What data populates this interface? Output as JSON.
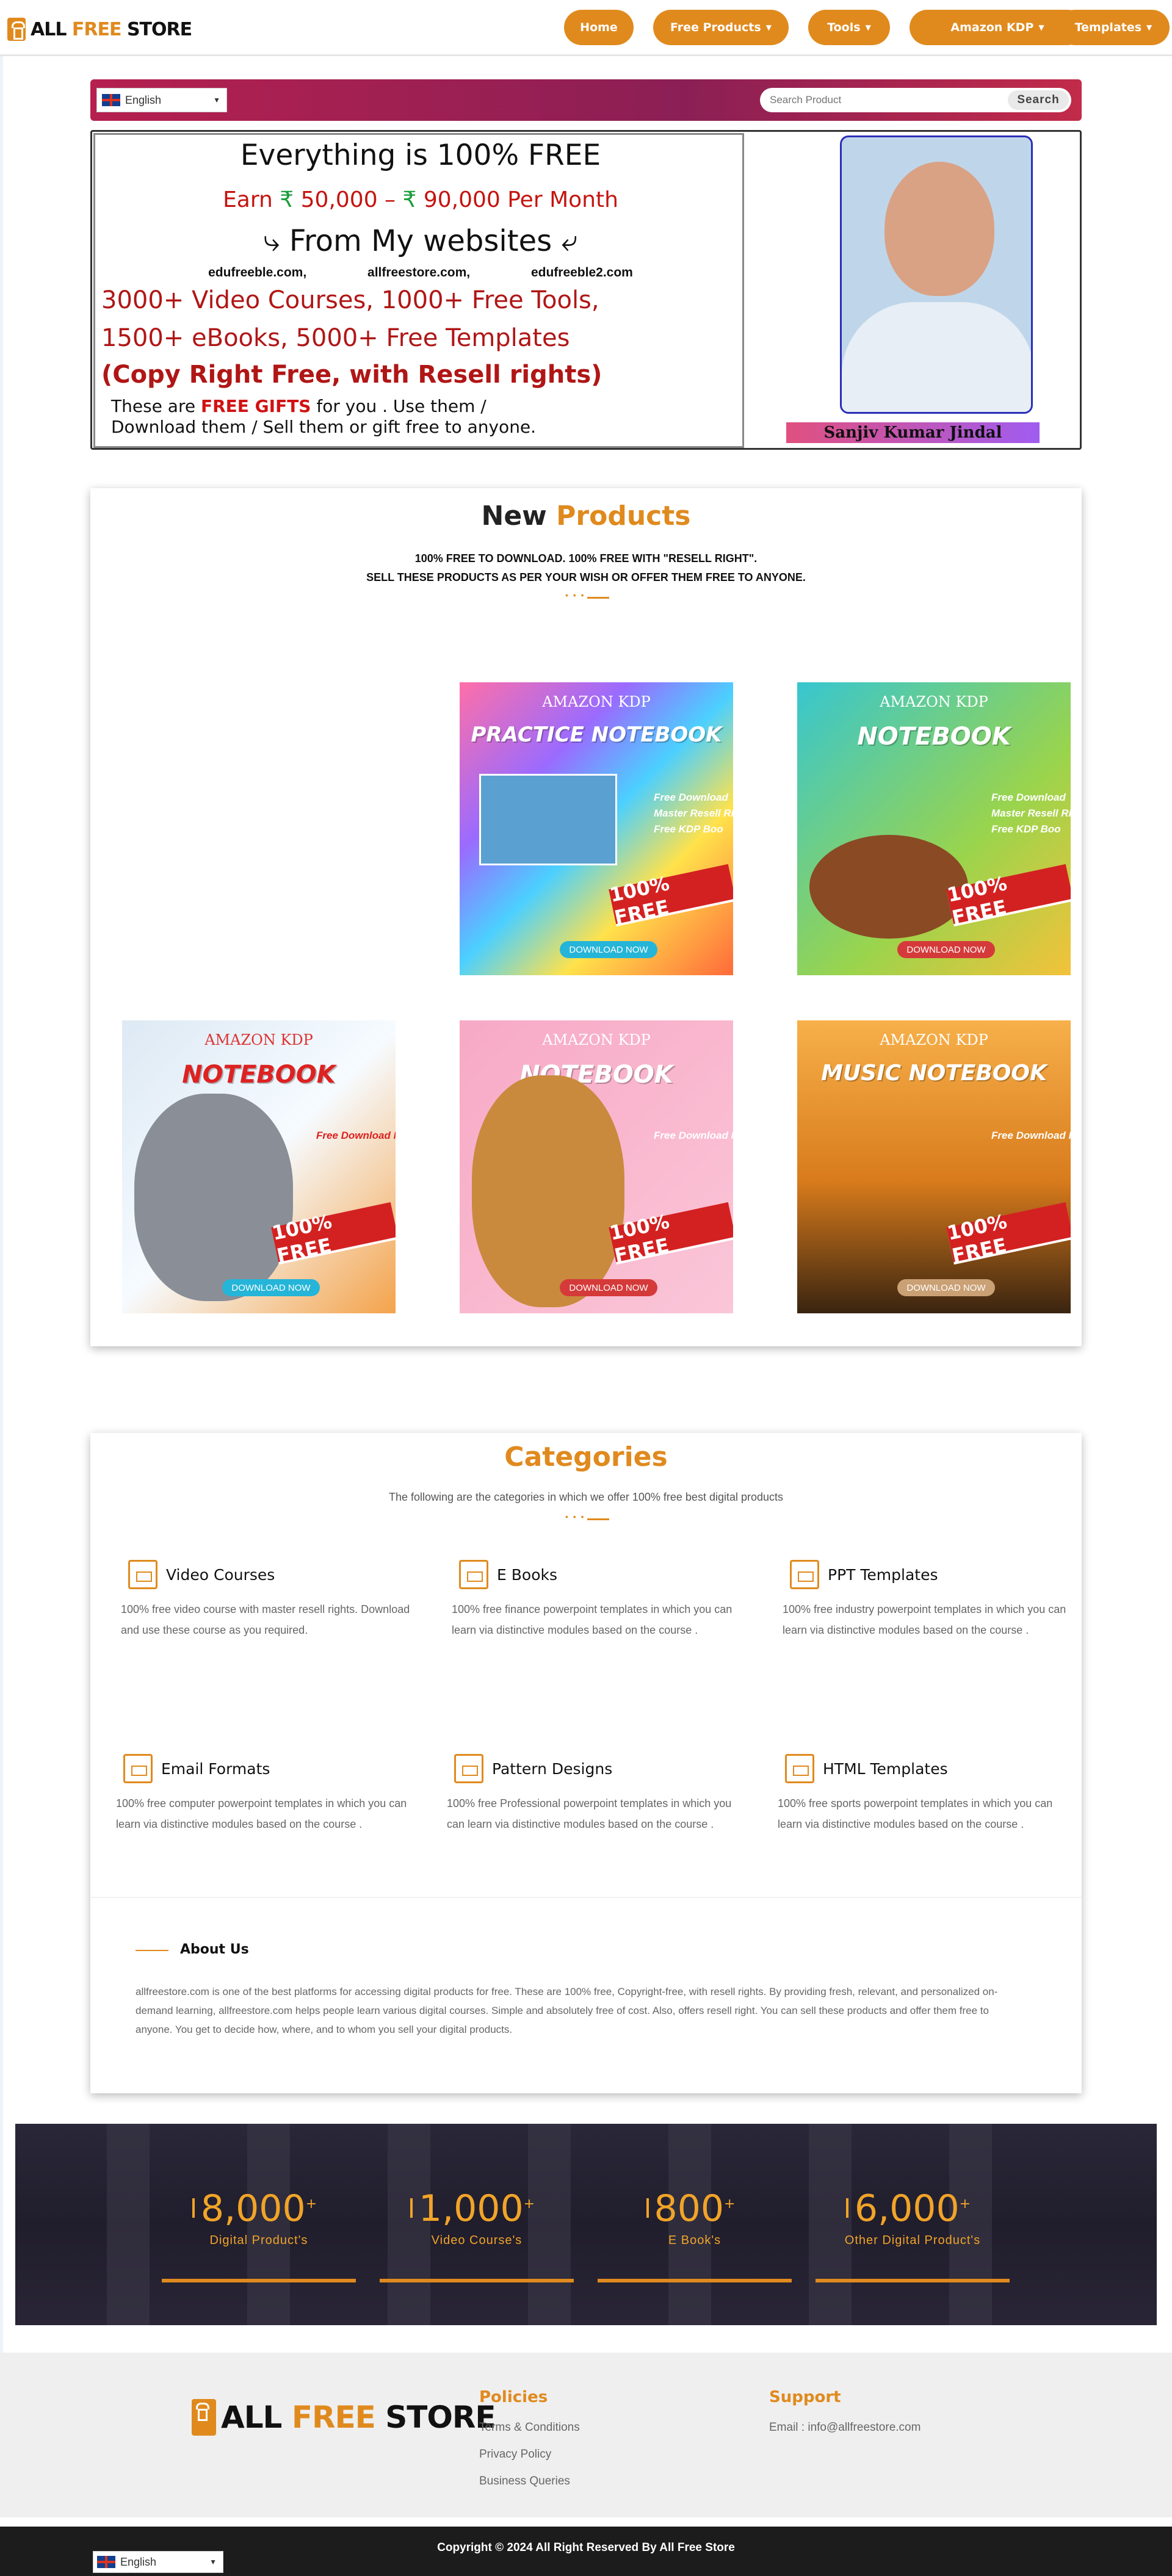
{
  "header": {
    "logo": {
      "all": "ALL ",
      "free": "FREE ",
      "store": "STORE"
    },
    "nav": [
      {
        "label": "Home"
      },
      {
        "label": "Free Products"
      },
      {
        "label": "Tools"
      },
      {
        "label": "Amazon KDP"
      },
      {
        "label": "Templates"
      }
    ]
  },
  "searchbar": {
    "language": "English",
    "search_placeholder": "Search Product",
    "search_button": "Search"
  },
  "hero": {
    "headline": "Everything is 100% FREE",
    "earn_prefix": "Earn ",
    "rupee": "₹",
    "amount1": " 50,000 – ",
    "amount2": " 90,000 Per Month",
    "from": "⤷ From My websites ⤶",
    "sites": [
      "edufreeble.com,",
      "allfreestore.com,",
      "edufreeble2.com"
    ],
    "line1": "3000+ Video Courses, 1000+ Free Tools,",
    "line2": "1500+ eBooks, 5000+ Free Templates",
    "line3": "(Copy Right Free, with Resell rights)",
    "gift_prefix": "These are ",
    "gift_bold": "FREE GIFTS",
    "gift_suffix": " for you . Use them / Download them / Sell them or gift free to anyone.",
    "person_name": "Sanjiv Kumar Jindal"
  },
  "new_products": {
    "title_a": "New ",
    "title_b": "Products",
    "sub1": "100% FREE TO DOWNLOAD. 100% FREE WITH \"RESELL RIGHT\".",
    "sub2": "SELL THESE PRODUCTS AS PER YOUR WISH OR OFFER THEM FREE TO ANYONE.",
    "items": [
      {
        "kdp": "AMAZON KDP",
        "title": "PRACTICE NOTEBOOK",
        "bullets": "Free Download\nMaster Resell Rig\nFree KDP Boo",
        "badge": "100% FREE",
        "cta": "DOWNLOAD NOW"
      },
      {
        "kdp": "AMAZON KDP",
        "title": "NOTEBOOK",
        "bullets": "Free Download\nMaster Resell Rig\nFree KDP Boo",
        "badge": "100% FREE",
        "cta": "DOWNLOAD NOW"
      },
      {
        "kdp": "AMAZON KDP",
        "title": "NOTEBOOK",
        "bullets": "Free Download\nMaster Resell Rig\nFree KDP Boo",
        "badge": "100% FREE",
        "cta": "DOWNLOAD NOW"
      },
      {
        "kdp": "AMAZON KDP",
        "title": "NOTEBOOK",
        "bullets": "Free Download\nMaster Resell Rig\nFree KDP Boo",
        "badge": "100% FREE",
        "cta": "DOWNLOAD NOW"
      },
      {
        "kdp": "AMAZON KDP",
        "title": "MUSIC NOTEBOOK",
        "bullets": "Free Download\nMaster Resell Rig\nFree KDP Boo",
        "badge": "100% FREE",
        "cta": "DOWNLOAD NOW"
      }
    ]
  },
  "categories": {
    "title": "Categories",
    "subtitle": "The following are the categories in which we offer 100% free best digital products",
    "items": [
      {
        "title": "Video Courses",
        "desc": "100% free video course with master resell rights. Download and use these course as you required."
      },
      {
        "title": "E Books",
        "desc": "100% free finance powerpoint templates in which you can learn via distinctive modules based on the course ."
      },
      {
        "title": "PPT Templates",
        "desc": "100% free industry powerpoint templates in which you can learn via distinctive modules based on the course ."
      },
      {
        "title": "Email Formats",
        "desc": "100% free computer powerpoint templates in which you can learn via distinctive modules based on the course ."
      },
      {
        "title": "Pattern Designs",
        "desc": "100% free Professional powerpoint templates in which you can learn via distinctive modules based on the course ."
      },
      {
        "title": "HTML Templates",
        "desc": "100% free sports powerpoint templates in which you can learn via distinctive modules based on the course ."
      }
    ],
    "about_title": "About Us",
    "about_text": "allfreestore.com is one of the best platforms for accessing digital products for free. These are 100% free, Copyright-free, with resell rights. By providing fresh, relevant, and personalized on-demand learning, allfreestore.com helps people learn various digital courses. Simple and absolutely free of cost. Also, offers resell right. You can sell these products and offer them free to anyone. You get to decide how, where, and to whom you sell your digital products."
  },
  "stats": [
    {
      "value": "8,000",
      "plus": "+",
      "label": "Digital Product's"
    },
    {
      "value": "1,000",
      "plus": "+",
      "label": "Video Course's"
    },
    {
      "value": "800",
      "plus": "+",
      "label": "E Book's"
    },
    {
      "value": "6,000",
      "plus": "+",
      "label": "Other Digital Product's"
    }
  ],
  "footer": {
    "policies_title": "Policies",
    "policies": [
      "Terms & Conditions",
      "Privacy Policy",
      "Business Queries"
    ],
    "support_title": "Support",
    "email": "Email : info@allfreestore.com",
    "copyright": "Copyright © 2024 All Right Reserved By All Free Store",
    "language": "English"
  },
  "colors": {
    "accent": "#e08a1e",
    "banner": "#b5204f",
    "red": "#c4140f",
    "dark": "#1c1c1c"
  }
}
